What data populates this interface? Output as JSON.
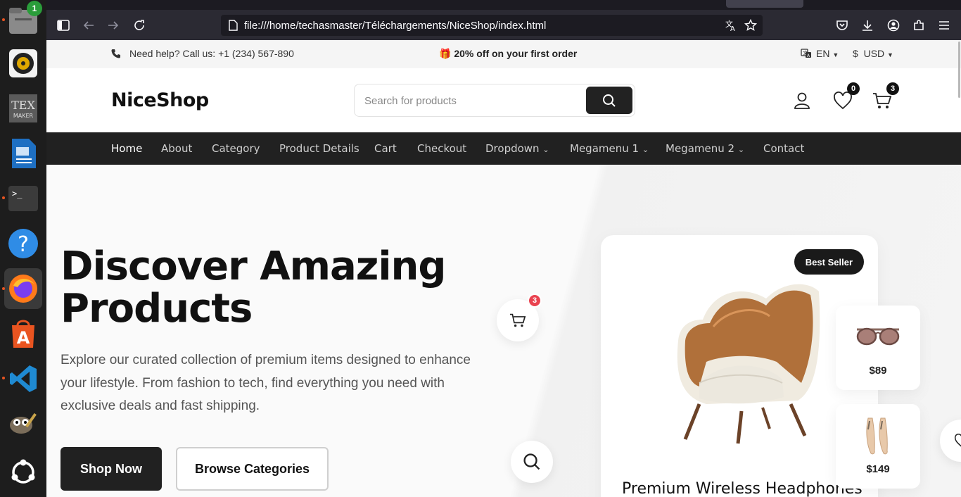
{
  "dock": {
    "items": [
      {
        "name": "files-icon",
        "badge": "1"
      },
      {
        "name": "rhythmbox-icon"
      },
      {
        "name": "texmaker-icon"
      },
      {
        "name": "libreoffice-writer-icon"
      },
      {
        "name": "terminal-icon"
      },
      {
        "name": "help-icon"
      },
      {
        "name": "firefox-icon"
      },
      {
        "name": "app-center-icon"
      },
      {
        "name": "vscode-icon"
      },
      {
        "name": "gimp-icon"
      },
      {
        "name": "show-apps-icon"
      }
    ]
  },
  "browser": {
    "url": "file:///home/techasmaster/Téléchargements/NiceShop/index.html"
  },
  "topbar": {
    "help": "Need help? Call us: +1 (234) 567-890",
    "promo": "🎁 20% off on your first order",
    "language": "EN",
    "currency_symbol": "$",
    "currency": "USD"
  },
  "header": {
    "logo": "NiceShop",
    "search_placeholder": "Search for products",
    "wishlist_count": "0",
    "cart_count": "3"
  },
  "nav": {
    "items": [
      {
        "label": "Home"
      },
      {
        "label": "About"
      },
      {
        "label": "Category"
      },
      {
        "label": "Product Details"
      },
      {
        "label": "Cart"
      },
      {
        "label": "Checkout"
      },
      {
        "label": "Dropdown"
      },
      {
        "label": "Megamenu 1"
      },
      {
        "label": "Megamenu 2"
      },
      {
        "label": "Contact"
      }
    ]
  },
  "hero": {
    "title_line1": "Discover Amazing",
    "title_line2": "Products",
    "description": "Explore our curated collection of premium items designed to enhance your lifestyle. From fashion to tech, find everything you need with exclusive deals and fast shipping.",
    "shop_now": "Shop Now",
    "browse_categories": "Browse Categories",
    "floating_cart_count": "3",
    "badge": "Best Seller",
    "product_name": "Premium Wireless Headphones",
    "mini_products": [
      {
        "price": "$89"
      },
      {
        "price": "$149"
      }
    ]
  },
  "colors": {
    "dark": "#212121",
    "badge_red": "#e9424f",
    "dock_bg": "#1d1d1d",
    "ubuntu_orange": "#e95420"
  }
}
